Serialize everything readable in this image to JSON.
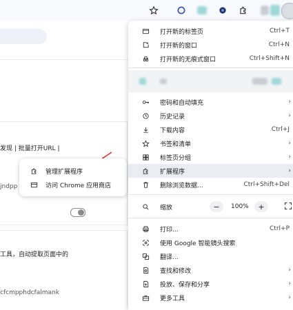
{
  "toolbar": {
    "icons": [
      "star-icon",
      "extension-circle-icon",
      "extension-blurred-icon",
      "extension-dark-icon",
      "puzzle-icon",
      "profile-avatar"
    ]
  },
  "page": {
    "line1": "发现 | 批量打开URL |",
    "line2": "jndpp",
    "line3": "工具，自动提取页面中的",
    "line4": "cfcmpphdcfalmank"
  },
  "extension_popup": {
    "items": [
      {
        "label": "管理扩展程序",
        "icon": "puzzle-icon"
      },
      {
        "label": "访问 Chrome 应用商店",
        "icon": "store-icon"
      }
    ]
  },
  "menu": {
    "items": {
      "new_tab": {
        "label": "打开新的标签页",
        "shortcut": "Ctrl+T"
      },
      "new_window": {
        "label": "打开新的窗口",
        "shortcut": "Ctrl+N"
      },
      "incognito": {
        "label": "打开新的无痕式窗口",
        "shortcut": "Ctrl+Shift+N"
      },
      "passwords": {
        "label": "密码和自动填充"
      },
      "history": {
        "label": "历史记录"
      },
      "downloads": {
        "label": "下载内容",
        "shortcut": "Ctrl+J"
      },
      "bookmarks": {
        "label": "书签和清单"
      },
      "tab_groups": {
        "label": "标签页分组"
      },
      "extensions": {
        "label": "扩展程序"
      },
      "clear_data": {
        "label": "删除浏览数据...",
        "shortcut": "Ctrl+Shift+Del"
      },
      "zoom": {
        "label": "缩放",
        "value": "100%",
        "minus": "−",
        "plus": "+"
      },
      "print": {
        "label": "打印...",
        "shortcut": "Ctrl+P"
      },
      "google_lens": {
        "label": "使用 Google 智能镜头搜索"
      },
      "translate": {
        "label": "翻译..."
      },
      "find_edit": {
        "label": "查找和修改"
      },
      "cast_save_share": {
        "label": "投放、保存和分享"
      },
      "more_tools": {
        "label": "更多工具"
      }
    }
  },
  "colors": {
    "menu_highlight": "#e9ecf2",
    "arrow_red": "#d93025",
    "blur_teal": "#9fd8d8",
    "blur_grey": "#c8ccd4"
  }
}
